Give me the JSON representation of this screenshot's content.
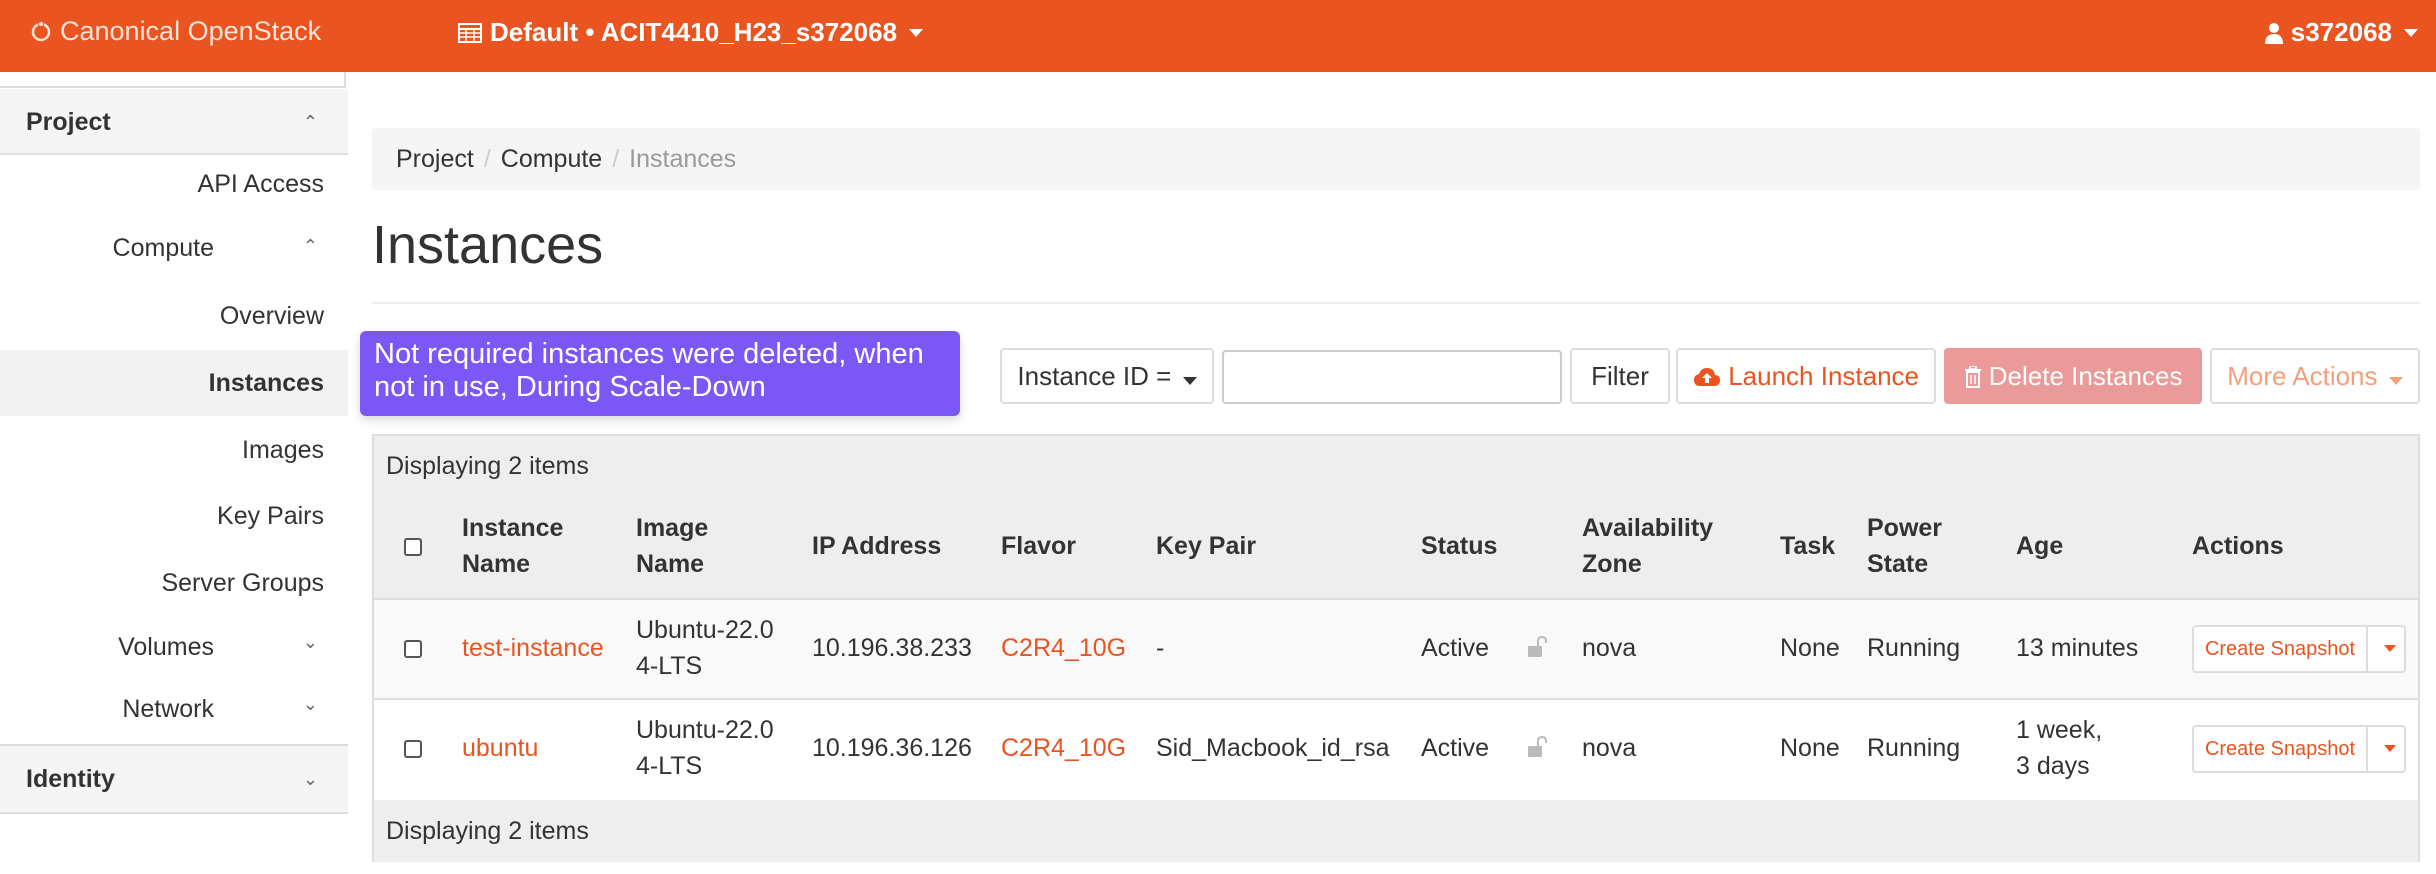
{
  "topbar": {
    "brand": "Canonical OpenStack",
    "project_switch": "Default • ACIT4410_H23_s372068",
    "user": "s372068"
  },
  "sidebar": {
    "project": "Project",
    "api_access": "API Access",
    "compute": "Compute",
    "overview": "Overview",
    "instances": "Instances",
    "images": "Images",
    "key_pairs": "Key Pairs",
    "server_groups": "Server Groups",
    "volumes": "Volumes",
    "network": "Network",
    "identity": "Identity"
  },
  "breadcrumb": {
    "project": "Project",
    "compute": "Compute",
    "current": "Instances"
  },
  "page": {
    "title": "Instances"
  },
  "tooltip": "Not required instances were deleted, when not in use, During Scale-Down",
  "toolbar": {
    "filter_field": "Instance ID =",
    "filter_button": "Filter",
    "launch": "Launch Instance",
    "delete": "Delete Instances",
    "more": "More Actions"
  },
  "table": {
    "caption": "Displaying 2 items",
    "headers": {
      "name_1": "Instance",
      "name_2": "Name",
      "image_1": "Image",
      "image_2": "Name",
      "ip": "IP Address",
      "flavor": "Flavor",
      "keypair": "Key Pair",
      "status": "Status",
      "az_1": "Availability",
      "az_2": "Zone",
      "task": "Task",
      "power_1": "Power",
      "power_2": "State",
      "age": "Age",
      "actions": "Actions"
    },
    "rows": [
      {
        "name": "test-instance",
        "image_1": "Ubuntu-22.0",
        "image_2": "4-LTS",
        "ip": "10.196.38.233",
        "flavor": "C2R4_10G",
        "keypair": "-",
        "status": "Active",
        "az": "nova",
        "task": "None",
        "power": "Running",
        "age_1": "13 minutes",
        "age_2": "",
        "action": "Create Snapshot"
      },
      {
        "name": "ubuntu",
        "image_1": "Ubuntu-22.0",
        "image_2": "4-LTS",
        "ip": "10.196.36.126",
        "flavor": "C2R4_10G",
        "keypair": "Sid_Macbook_id_rsa",
        "status": "Active",
        "az": "nova",
        "task": "None",
        "power": "Running",
        "age_1": "1 week,",
        "age_2": "3 days",
        "action": "Create Snapshot"
      }
    ],
    "footer": "Displaying 2 items"
  },
  "colors": {
    "brand": "#e95420",
    "tooltip": "#7b57f5",
    "delete": "#ea9a98"
  }
}
